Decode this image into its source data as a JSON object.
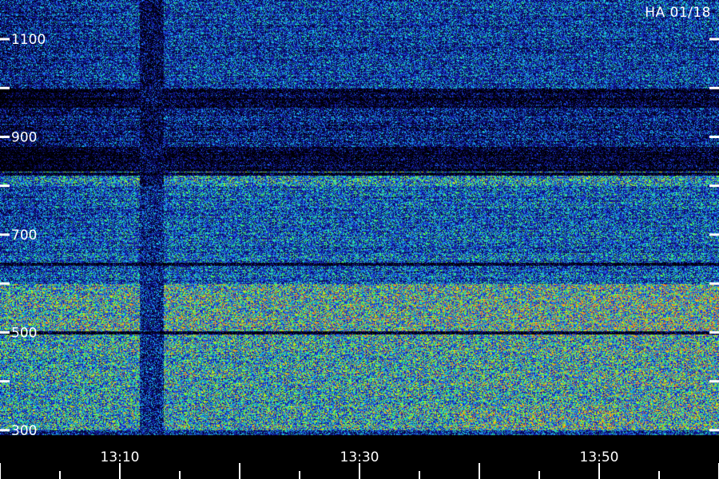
{
  "title": "HA 01/18",
  "chart_data": {
    "type": "heatmap",
    "title": "HA 01/18",
    "xlabel": "",
    "ylabel": "",
    "x_tick_labels": [
      "13:10",
      "13:30",
      "13:50"
    ],
    "x_tick_minutes": [
      790,
      810,
      830
    ],
    "xlim_minutes": [
      780,
      840
    ],
    "y_tick_labels": [
      "1100",
      "900",
      "700",
      "500",
      "300"
    ],
    "y_tick_values": [
      1100,
      900,
      700,
      500,
      300
    ],
    "ylim": [
      290,
      1180
    ],
    "colormap": [
      "#000000",
      "#0a0a6e",
      "#1e28d2",
      "#1e8cff",
      "#19d2e6",
      "#28f07d",
      "#78ff1e",
      "#e6e614",
      "#ff7814"
    ],
    "gap_interval_minutes": [
      791.6,
      793.6
    ],
    "bands": [
      {
        "from": 1000,
        "to": 1180,
        "level": 0.35
      },
      {
        "from": 960,
        "to": 1000,
        "level": 0.05
      },
      {
        "from": 880,
        "to": 960,
        "level": 0.25
      },
      {
        "from": 830,
        "to": 880,
        "level": 0.05
      },
      {
        "from": 800,
        "to": 830,
        "level": 0.6
      },
      {
        "from": 600,
        "to": 800,
        "level": 0.45
      },
      {
        "from": 500,
        "to": 600,
        "level": 0.8
      },
      {
        "from": 300,
        "to": 500,
        "level": 0.7
      }
    ],
    "dark_lines": [
      825,
      640,
      500
    ],
    "hot_region": {
      "x_minutes": [
        818,
        834
      ],
      "y": [
        300,
        340
      ],
      "level": 0.95
    }
  }
}
